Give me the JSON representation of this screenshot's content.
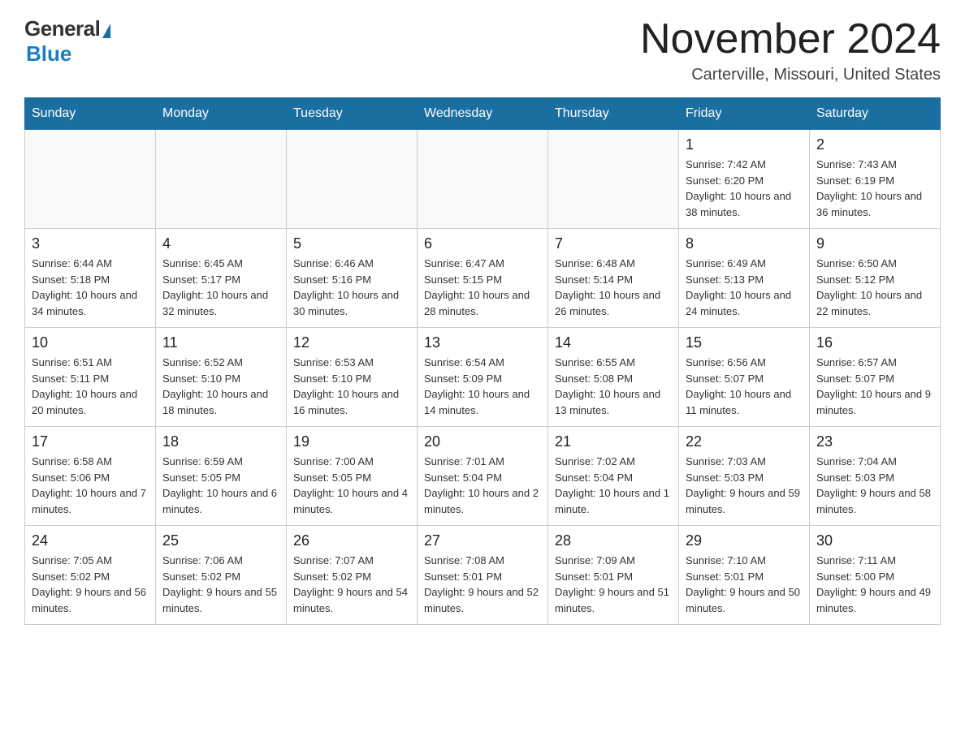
{
  "header": {
    "logo_general": "General",
    "logo_blue": "Blue",
    "month_title": "November 2024",
    "location": "Carterville, Missouri, United States"
  },
  "days_of_week": [
    "Sunday",
    "Monday",
    "Tuesday",
    "Wednesday",
    "Thursday",
    "Friday",
    "Saturday"
  ],
  "weeks": [
    {
      "days": [
        {
          "number": "",
          "info": ""
        },
        {
          "number": "",
          "info": ""
        },
        {
          "number": "",
          "info": ""
        },
        {
          "number": "",
          "info": ""
        },
        {
          "number": "",
          "info": ""
        },
        {
          "number": "1",
          "info": "Sunrise: 7:42 AM\nSunset: 6:20 PM\nDaylight: 10 hours and 38 minutes."
        },
        {
          "number": "2",
          "info": "Sunrise: 7:43 AM\nSunset: 6:19 PM\nDaylight: 10 hours and 36 minutes."
        }
      ]
    },
    {
      "days": [
        {
          "number": "3",
          "info": "Sunrise: 6:44 AM\nSunset: 5:18 PM\nDaylight: 10 hours and 34 minutes."
        },
        {
          "number": "4",
          "info": "Sunrise: 6:45 AM\nSunset: 5:17 PM\nDaylight: 10 hours and 32 minutes."
        },
        {
          "number": "5",
          "info": "Sunrise: 6:46 AM\nSunset: 5:16 PM\nDaylight: 10 hours and 30 minutes."
        },
        {
          "number": "6",
          "info": "Sunrise: 6:47 AM\nSunset: 5:15 PM\nDaylight: 10 hours and 28 minutes."
        },
        {
          "number": "7",
          "info": "Sunrise: 6:48 AM\nSunset: 5:14 PM\nDaylight: 10 hours and 26 minutes."
        },
        {
          "number": "8",
          "info": "Sunrise: 6:49 AM\nSunset: 5:13 PM\nDaylight: 10 hours and 24 minutes."
        },
        {
          "number": "9",
          "info": "Sunrise: 6:50 AM\nSunset: 5:12 PM\nDaylight: 10 hours and 22 minutes."
        }
      ]
    },
    {
      "days": [
        {
          "number": "10",
          "info": "Sunrise: 6:51 AM\nSunset: 5:11 PM\nDaylight: 10 hours and 20 minutes."
        },
        {
          "number": "11",
          "info": "Sunrise: 6:52 AM\nSunset: 5:10 PM\nDaylight: 10 hours and 18 minutes."
        },
        {
          "number": "12",
          "info": "Sunrise: 6:53 AM\nSunset: 5:10 PM\nDaylight: 10 hours and 16 minutes."
        },
        {
          "number": "13",
          "info": "Sunrise: 6:54 AM\nSunset: 5:09 PM\nDaylight: 10 hours and 14 minutes."
        },
        {
          "number": "14",
          "info": "Sunrise: 6:55 AM\nSunset: 5:08 PM\nDaylight: 10 hours and 13 minutes."
        },
        {
          "number": "15",
          "info": "Sunrise: 6:56 AM\nSunset: 5:07 PM\nDaylight: 10 hours and 11 minutes."
        },
        {
          "number": "16",
          "info": "Sunrise: 6:57 AM\nSunset: 5:07 PM\nDaylight: 10 hours and 9 minutes."
        }
      ]
    },
    {
      "days": [
        {
          "number": "17",
          "info": "Sunrise: 6:58 AM\nSunset: 5:06 PM\nDaylight: 10 hours and 7 minutes."
        },
        {
          "number": "18",
          "info": "Sunrise: 6:59 AM\nSunset: 5:05 PM\nDaylight: 10 hours and 6 minutes."
        },
        {
          "number": "19",
          "info": "Sunrise: 7:00 AM\nSunset: 5:05 PM\nDaylight: 10 hours and 4 minutes."
        },
        {
          "number": "20",
          "info": "Sunrise: 7:01 AM\nSunset: 5:04 PM\nDaylight: 10 hours and 2 minutes."
        },
        {
          "number": "21",
          "info": "Sunrise: 7:02 AM\nSunset: 5:04 PM\nDaylight: 10 hours and 1 minute."
        },
        {
          "number": "22",
          "info": "Sunrise: 7:03 AM\nSunset: 5:03 PM\nDaylight: 9 hours and 59 minutes."
        },
        {
          "number": "23",
          "info": "Sunrise: 7:04 AM\nSunset: 5:03 PM\nDaylight: 9 hours and 58 minutes."
        }
      ]
    },
    {
      "days": [
        {
          "number": "24",
          "info": "Sunrise: 7:05 AM\nSunset: 5:02 PM\nDaylight: 9 hours and 56 minutes."
        },
        {
          "number": "25",
          "info": "Sunrise: 7:06 AM\nSunset: 5:02 PM\nDaylight: 9 hours and 55 minutes."
        },
        {
          "number": "26",
          "info": "Sunrise: 7:07 AM\nSunset: 5:02 PM\nDaylight: 9 hours and 54 minutes."
        },
        {
          "number": "27",
          "info": "Sunrise: 7:08 AM\nSunset: 5:01 PM\nDaylight: 9 hours and 52 minutes."
        },
        {
          "number": "28",
          "info": "Sunrise: 7:09 AM\nSunset: 5:01 PM\nDaylight: 9 hours and 51 minutes."
        },
        {
          "number": "29",
          "info": "Sunrise: 7:10 AM\nSunset: 5:01 PM\nDaylight: 9 hours and 50 minutes."
        },
        {
          "number": "30",
          "info": "Sunrise: 7:11 AM\nSunset: 5:00 PM\nDaylight: 9 hours and 49 minutes."
        }
      ]
    }
  ]
}
